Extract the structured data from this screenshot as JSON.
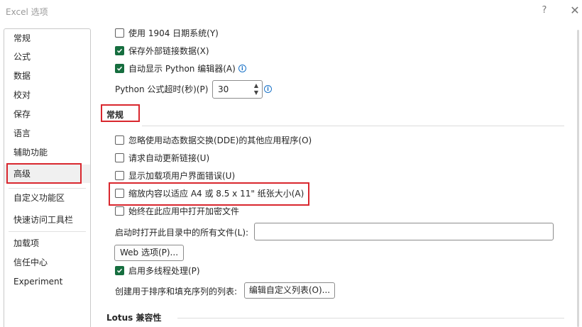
{
  "window": {
    "title": "Excel 选项",
    "help_label": "?",
    "close_label": "✕"
  },
  "sidebar": {
    "items": [
      {
        "label": "常规"
      },
      {
        "label": "公式"
      },
      {
        "label": "数据"
      },
      {
        "label": "校对"
      },
      {
        "label": "保存"
      },
      {
        "label": "语言"
      },
      {
        "label": "辅助功能"
      },
      {
        "label": "高级",
        "selected": true
      },
      {
        "label": "自定义功能区"
      },
      {
        "label": "快速访问工具栏"
      },
      {
        "label": "加载项"
      },
      {
        "label": "信任中心"
      },
      {
        "label": "Experiment"
      }
    ]
  },
  "content": {
    "top_options": [
      {
        "label": "使用 1904 日期系统(Y)",
        "checked": false
      },
      {
        "label": "保存外部链接数据(X)",
        "checked": true
      },
      {
        "label": "自动显示 Python 编辑器(A)",
        "checked": true,
        "info": true
      }
    ],
    "python_timeout": {
      "label": "Python 公式超时(秒)(P)",
      "value": "30"
    },
    "general_section": {
      "title": "常规",
      "options": [
        {
          "label": "忽略使用动态数据交换(DDE)的其他应用程序(O)",
          "checked": false
        },
        {
          "label": "请求自动更新链接(U)",
          "checked": false
        },
        {
          "label": "显示加载项用户界面错误(U)",
          "checked": false
        },
        {
          "label": "缩放内容以适应 A4 或 8.5 x 11\" 纸张大小(A)",
          "checked": false
        },
        {
          "label": "始终在此应用中打开加密文件",
          "checked": false
        }
      ],
      "startup_label": "启动时打开此目录中的所有文件(L):",
      "startup_value": "",
      "web_options_button": "Web 选项(P)...",
      "multithread": {
        "label": "启用多线程处理(P)",
        "checked": true
      },
      "custom_list_label": "创建用于排序和填充序列的列表:",
      "custom_list_button": "编辑自定义列表(O)..."
    },
    "lotus_section": {
      "title": "Lotus 兼容性"
    }
  },
  "colors": {
    "accent": "#166e3f",
    "highlight": "#d9272e",
    "info": "#1a73c8"
  }
}
